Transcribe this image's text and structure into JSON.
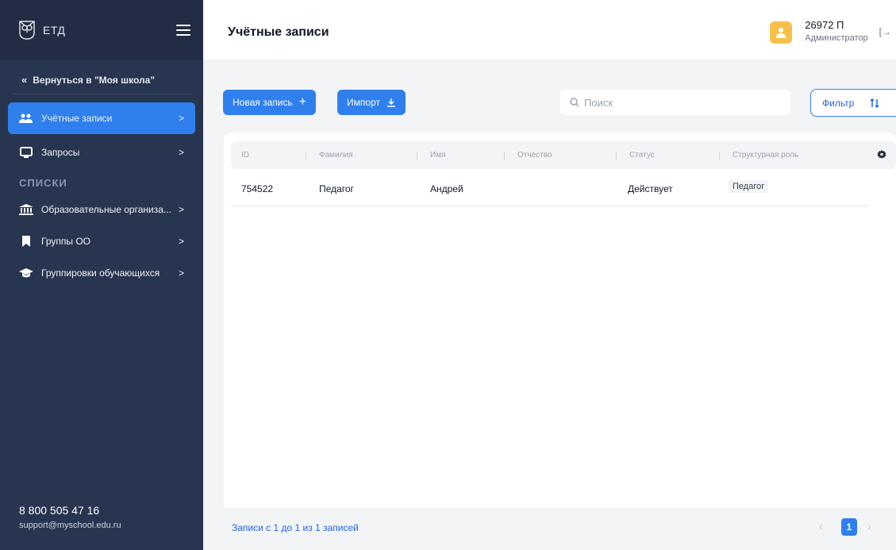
{
  "sidebar": {
    "logo_text": "ЕТД",
    "back_label": "Вернуться в \"Моя школа\"",
    "items": [
      {
        "label": "Учётные записи",
        "icon": "users-icon",
        "active": true
      },
      {
        "label": "Запросы",
        "icon": "monitor-icon",
        "active": false
      }
    ],
    "section_title": "СПИСКИ",
    "list_items": [
      {
        "label": "Образовательные организа...",
        "icon": "institution-icon"
      },
      {
        "label": "Группы ОО",
        "icon": "bookmark-icon"
      },
      {
        "label": "Группировки обучающихся",
        "icon": "graduation-cap-icon"
      }
    ],
    "phone": "8 800 505 47 16",
    "email": "support@myschool.edu.ru"
  },
  "header": {
    "title": "Учётные записи",
    "user_name": "26972 П",
    "user_role": "Администратор"
  },
  "toolbar": {
    "new_record_label": "Новая запись",
    "import_label": "Импорт",
    "search_placeholder": "Поиск",
    "filter_label": "Фильтр"
  },
  "table": {
    "columns": [
      "ID",
      "Фамилия",
      "Имя",
      "Отчество",
      "Статус",
      "Структурная роль"
    ],
    "rows": [
      {
        "id": "754522",
        "last_name": "Педагог",
        "first_name": "Андрей",
        "patronymic": "",
        "status": "Действует",
        "role": "Педагог"
      }
    ]
  },
  "pagination": {
    "summary": "Записи с 1 до 1 из 1 записей",
    "current_page": "1",
    "prev": "‹",
    "next": "›"
  },
  "colors": {
    "accent": "#2f80ed",
    "sidebar_bg": "#283550",
    "avatar": "#f7c04a"
  }
}
